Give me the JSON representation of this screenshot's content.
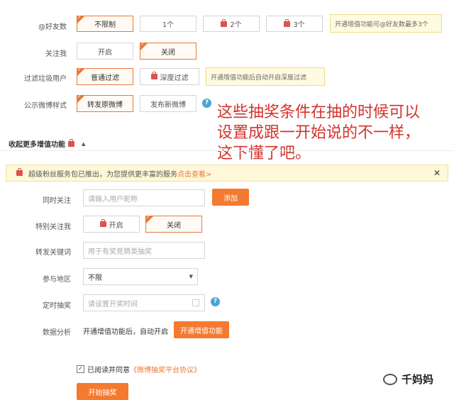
{
  "friends": {
    "label": "@好友数",
    "options": [
      "不限制",
      "1个",
      "2个",
      "3个"
    ],
    "tip": "开通增值功能可@好友数最多3个"
  },
  "follow": {
    "label": "关注我",
    "options": [
      "开启",
      "关闭"
    ]
  },
  "spam": {
    "label": "过滤垃圾用户",
    "options": [
      "普通过滤",
      "深度过滤"
    ],
    "tip": "开通增值功能后自动开启深度过滤"
  },
  "publish": {
    "label": "公示微博样式",
    "options": [
      "转发原微博",
      "发布新微博"
    ],
    "help": "?"
  },
  "annotation": {
    "line1": "这些抽奖条件在抽的时候可以",
    "line2": "设置成跟一开始说的不一样，",
    "line3": "这下懂了吧。"
  },
  "collapse": {
    "label": "收起更多增值功能",
    "arrow": "▲"
  },
  "banner": {
    "text": "超级粉丝服务包已推出，为您提供更丰富的服务",
    "link": "点击查看>",
    "close": "✕"
  },
  "sim_follow": {
    "label": "同时关注",
    "placeholder": "请输入用户昵称",
    "button": "添加"
  },
  "special_follow": {
    "label": "特别关注我",
    "options": [
      "开启",
      "关闭"
    ]
  },
  "keyword": {
    "label": "转发关键词",
    "placeholder": "用于有奖竞猜类抽奖"
  },
  "region": {
    "label": "参与地区",
    "value": "不限",
    "caret": "▼"
  },
  "timer": {
    "label": "定时抽奖",
    "placeholder": "请设置开奖时间",
    "help": "?"
  },
  "analysis": {
    "label": "数据分析",
    "text": "开通增值功能后，自动开启",
    "button": "开通增值功能"
  },
  "agreement": {
    "text": "已阅读并同意",
    "link": "《微博抽奖平台协议》"
  },
  "start_button": "开始抽奖",
  "watermark": {
    "text": "千妈妈"
  }
}
